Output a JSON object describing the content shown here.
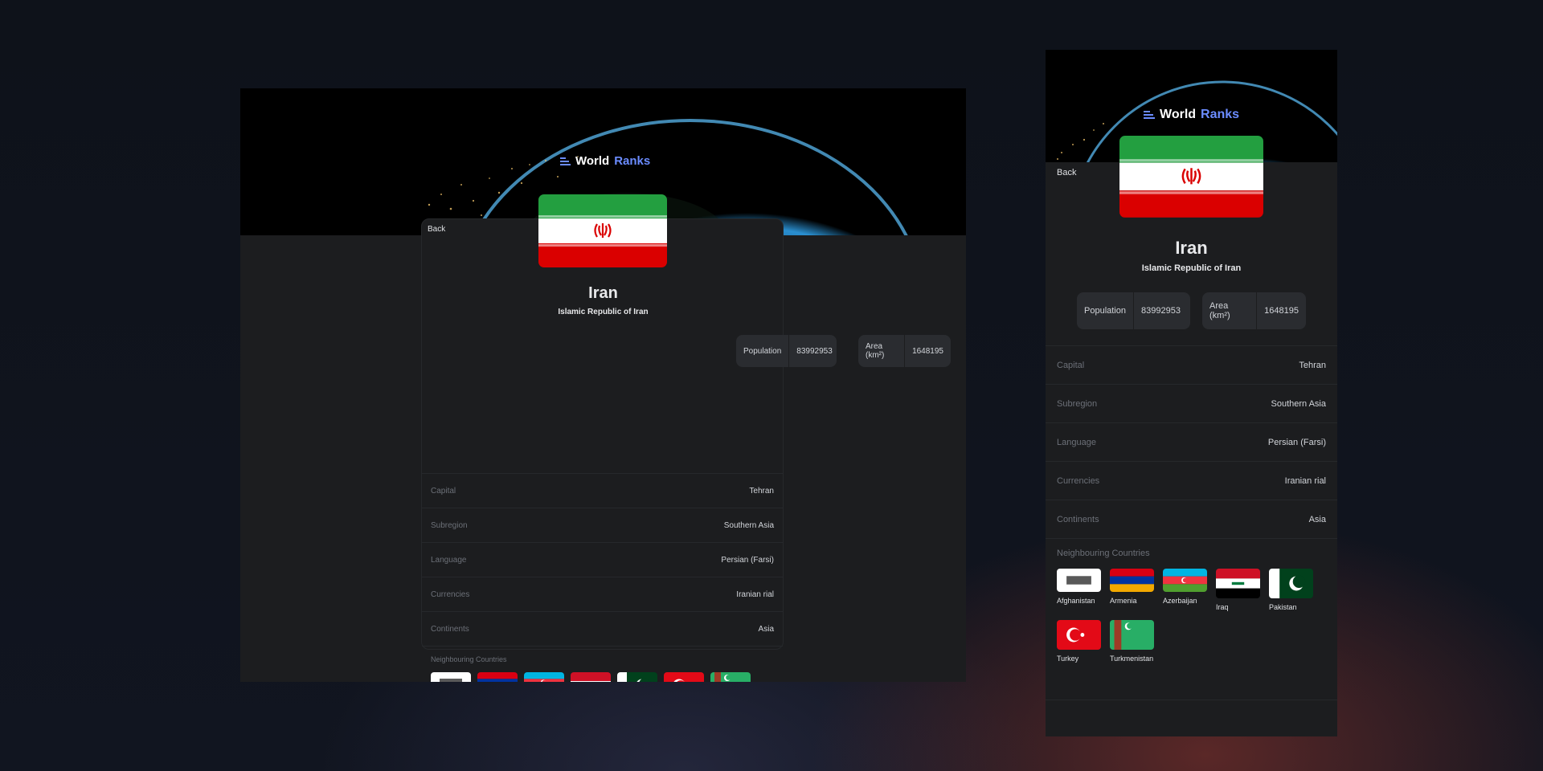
{
  "app": {
    "logo_word1": "World",
    "logo_word2": "Ranks",
    "back_label": "Back"
  },
  "country": {
    "name": "Iran",
    "official_name": "Islamic Republic of Iran",
    "population_label": "Population",
    "population_value": "83992953",
    "area_label": "Area (km²)",
    "area_value": "1648195"
  },
  "details": [
    {
      "label": "Capital",
      "value": "Tehran"
    },
    {
      "label": "Subregion",
      "value": "Southern Asia"
    },
    {
      "label": "Language",
      "value": "Persian (Farsi)"
    },
    {
      "label": "Currencies",
      "value": "Iranian rial"
    },
    {
      "label": "Continents",
      "value": "Asia"
    }
  ],
  "neighbours": {
    "title": "Neighbouring Countries",
    "items": [
      {
        "name": "Afghanistan"
      },
      {
        "name": "Armenia"
      },
      {
        "name": "Azerbaijan"
      },
      {
        "name": "Iraq"
      },
      {
        "name": "Pakistan"
      },
      {
        "name": "Turkey"
      },
      {
        "name": "Turkmenistan"
      }
    ]
  },
  "colors": {
    "accent": "#6b8cff",
    "card_bg": "#1c1d1f",
    "stat_bg": "#2a2c30",
    "muted_text": "#6c7078"
  },
  "icons": {
    "logo": "bar-chart-icon"
  }
}
